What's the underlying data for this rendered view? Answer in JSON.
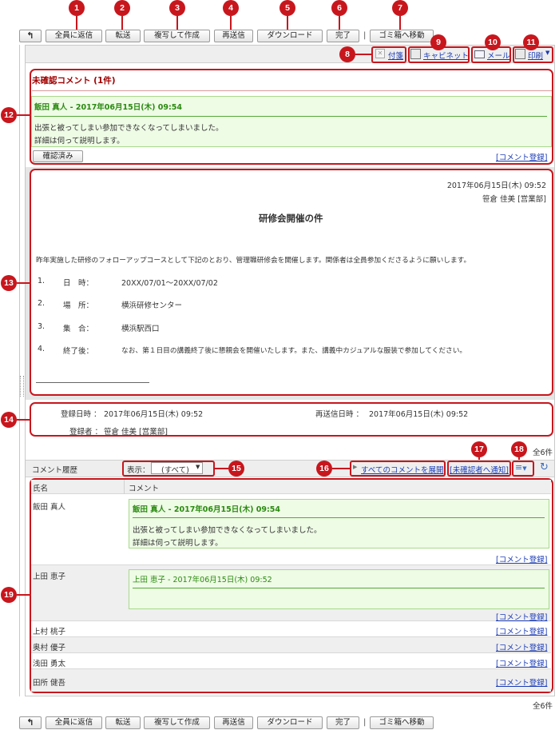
{
  "toolbar": {
    "back_icon": "back-arrow-icon",
    "reply_all": "全員に返信",
    "forward": "転送",
    "copy_create": "複写して作成",
    "resend": "再送信",
    "download": "ダウンロード",
    "complete": "完了",
    "separator": "|",
    "move_trash": "ゴミ箱へ移動"
  },
  "markers": [
    "1",
    "2",
    "3",
    "4",
    "5",
    "6",
    "7",
    "8",
    "9",
    "10",
    "11",
    "12",
    "13",
    "14",
    "15",
    "16",
    "17",
    "18",
    "19"
  ],
  "actions": {
    "sticky": "付箋",
    "cabinet": "キャビネット",
    "mail": "メール",
    "print": "印刷"
  },
  "unconfirmed": {
    "title": "未確認コメント (1件)",
    "comment_header": "飯田 真人  - 2017年06月15日(木) 09:54",
    "line1": "出張と被ってしまい参加できなくなってしまいました。",
    "line2": "詳細は伺って説明します。",
    "confirm_button": "確認済み",
    "register_link": "[コメント登録]"
  },
  "document": {
    "datetime": "2017年06月15日(木) 09:52",
    "author": "笹倉 佳美 [営業部]",
    "title": "研修会開催の件",
    "intro": "昨年実施した研修のフォローアップコースとして下記のとおり、管理職研修会を開催します。関係者は全員参加くださるように願いします。",
    "items": [
      {
        "num": "1.",
        "label": "日　時：",
        "value": "20XX/07/01～20XX/07/02"
      },
      {
        "num": "2.",
        "label": "場　所：",
        "value": "横浜研修センター"
      },
      {
        "num": "3.",
        "label": "集　合：",
        "value": "横浜駅西口"
      },
      {
        "num": "4.",
        "label": "終了後：",
        "value": "なお、第１日目の講義終了後に懇親会を開催いたします。また、講義中カジュアルな服装で参加してください。"
      }
    ]
  },
  "meta": {
    "reg_label": "登録日時 ：",
    "reg_value": "2017年06月15日(木) 09:52",
    "resend_label": "再送信日時 ：",
    "resend_value": "2017年06月15日(木) 09:52",
    "registrant_label": "登録者 ：",
    "registrant_value": "笹倉 佳美 [営業部]"
  },
  "history": {
    "total_top": "全6件",
    "total_bottom": "全6件",
    "title": "コメント履歴",
    "display_label": "表示：",
    "display_value": "(すべて)",
    "expand_all": "すべてのコメントを展開",
    "notify_unconfirmed": "[未確認者へ通知]",
    "col_name": "氏名",
    "col_comment": "コメント",
    "register_link": "[コメント登録]",
    "rows": [
      {
        "name": "飯田 真人",
        "header": "飯田 真人  - 2017年06月15日(木) 09:54",
        "line1": "出張と被ってしまい参加できなくなってしまいました。",
        "line2": "詳細は伺って説明します。"
      },
      {
        "name": "上田 恵子",
        "header": "上田 恵子  - 2017年06月15日(木) 09:52"
      },
      {
        "name": "上村 桃子"
      },
      {
        "name": "奥村 優子"
      },
      {
        "name": "浅田 勇太"
      },
      {
        "name": "田所 健吾"
      }
    ]
  }
}
